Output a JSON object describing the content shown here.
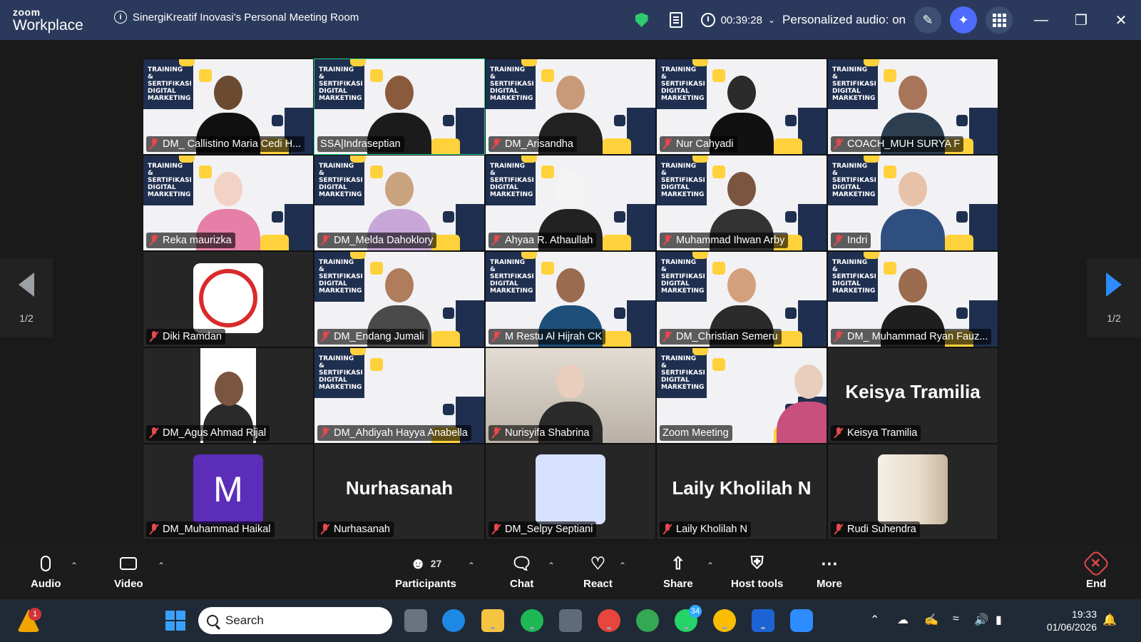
{
  "titlebar": {
    "brand_top": "zoom",
    "brand_bottom": "Workplace",
    "meeting_title": "SinergiKreatif Inovasi's Personal Meeting Room",
    "timer": "00:39:28",
    "audio_status": "Personalized audio: on"
  },
  "pager": {
    "left": "1/2",
    "right": "1/2"
  },
  "slide_text": "TRAINING & SERTIFIKASI DIGITAL MARKETING",
  "participants": [
    {
      "name": "DM_ Callistino Maria Cedi H...",
      "muted": true
    },
    {
      "name": "SSA|Indraseptian",
      "muted": false,
      "active": true
    },
    {
      "name": "DM_Arisandha",
      "muted": true
    },
    {
      "name": "Nur Cahyadi",
      "muted": true
    },
    {
      "name": "COACH_MUH SURYA F",
      "muted": true
    },
    {
      "name": "Reka maurizka",
      "muted": true
    },
    {
      "name": "DM_Melda Dahoklory",
      "muted": true
    },
    {
      "name": "Ahyaa R. Athaullah",
      "muted": true
    },
    {
      "name": "Muhammad Ihwan Arby",
      "muted": true
    },
    {
      "name": "Indri",
      "muted": true
    },
    {
      "name": "Diki Ramdan",
      "muted": true
    },
    {
      "name": "DM_Endang Jumali",
      "muted": true
    },
    {
      "name": "M Restu Al Hijrah CK",
      "muted": true
    },
    {
      "name": "DM_Christian Semeru",
      "muted": true
    },
    {
      "name": "DM_ Muhammad Ryan Fauz...",
      "muted": true
    },
    {
      "name": "DM_Agus Ahmad Rijal",
      "muted": true
    },
    {
      "name": "DM_Ahdiyah Hayya Anabella",
      "muted": true
    },
    {
      "name": "Nurisyifa Shabrina",
      "muted": true
    },
    {
      "name": "Zoom Meeting",
      "muted": false
    },
    {
      "name": "Keisya Tramilia",
      "muted": true,
      "big_name": "Keisya Tramilia"
    },
    {
      "name": "DM_Muhammad Haikal",
      "muted": true,
      "avatar_letter": "M"
    },
    {
      "name": "Nurhasanah",
      "muted": true,
      "big_name": "Nurhasanah"
    },
    {
      "name": "DM_Selpy Septiani",
      "muted": true
    },
    {
      "name": "Laily Kholilah N",
      "muted": true,
      "big_name": "Laily Kholilah N"
    },
    {
      "name": "Rudi Suhendra",
      "muted": true
    }
  ],
  "toolbar": {
    "audio": "Audio",
    "video": "Video",
    "participants": "Participants",
    "participants_count": "27",
    "chat": "Chat",
    "react": "React",
    "share": "Share",
    "host_tools": "Host tools",
    "more": "More",
    "end": "End"
  },
  "taskbar": {
    "search_placeholder": "Search",
    "alert_badge": "1",
    "whatsapp_badge": "34",
    "time": "19:33",
    "date": "01/06/2026"
  },
  "colors": {
    "titlebar": "#2b3a5c",
    "active_speaker": "#23d18b",
    "muted_red": "#e5484d",
    "accent_blue": "#2f8cff"
  }
}
